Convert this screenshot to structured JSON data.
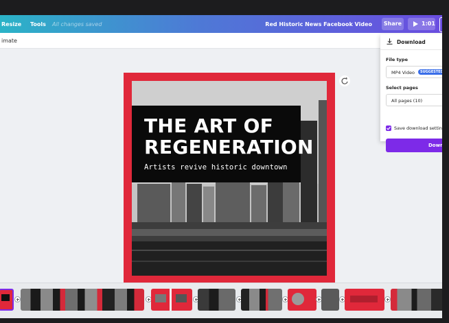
{
  "topbar": {
    "resize_label": "Resize",
    "tools_label": "Tools",
    "save_status": "All changes saved",
    "document_title": "Red Historic News Facebook Video",
    "share_label": "Share",
    "play_label": "1:01"
  },
  "toolbar": {
    "animate_label": "imate"
  },
  "design": {
    "headline_line1": "THE ART OF",
    "headline_line2": "REGENERATION",
    "subtitle": "Artists revive historic downtown"
  },
  "download_panel": {
    "title": "Download",
    "file_type_label": "File type",
    "file_type_value": "MP4 Video",
    "suggested_badge": "SUGGESTED",
    "select_pages_label": "Select pages",
    "pages_value": "All pages (10)",
    "save_settings_label": "Save download settin",
    "save_settings_checked": true,
    "download_button": "Down"
  },
  "colors": {
    "accent_purple": "#7d2ae8",
    "frame_red": "#e0283a",
    "topbar_gradient_start": "#2bb3c7",
    "topbar_gradient_end": "#6a4de0"
  }
}
